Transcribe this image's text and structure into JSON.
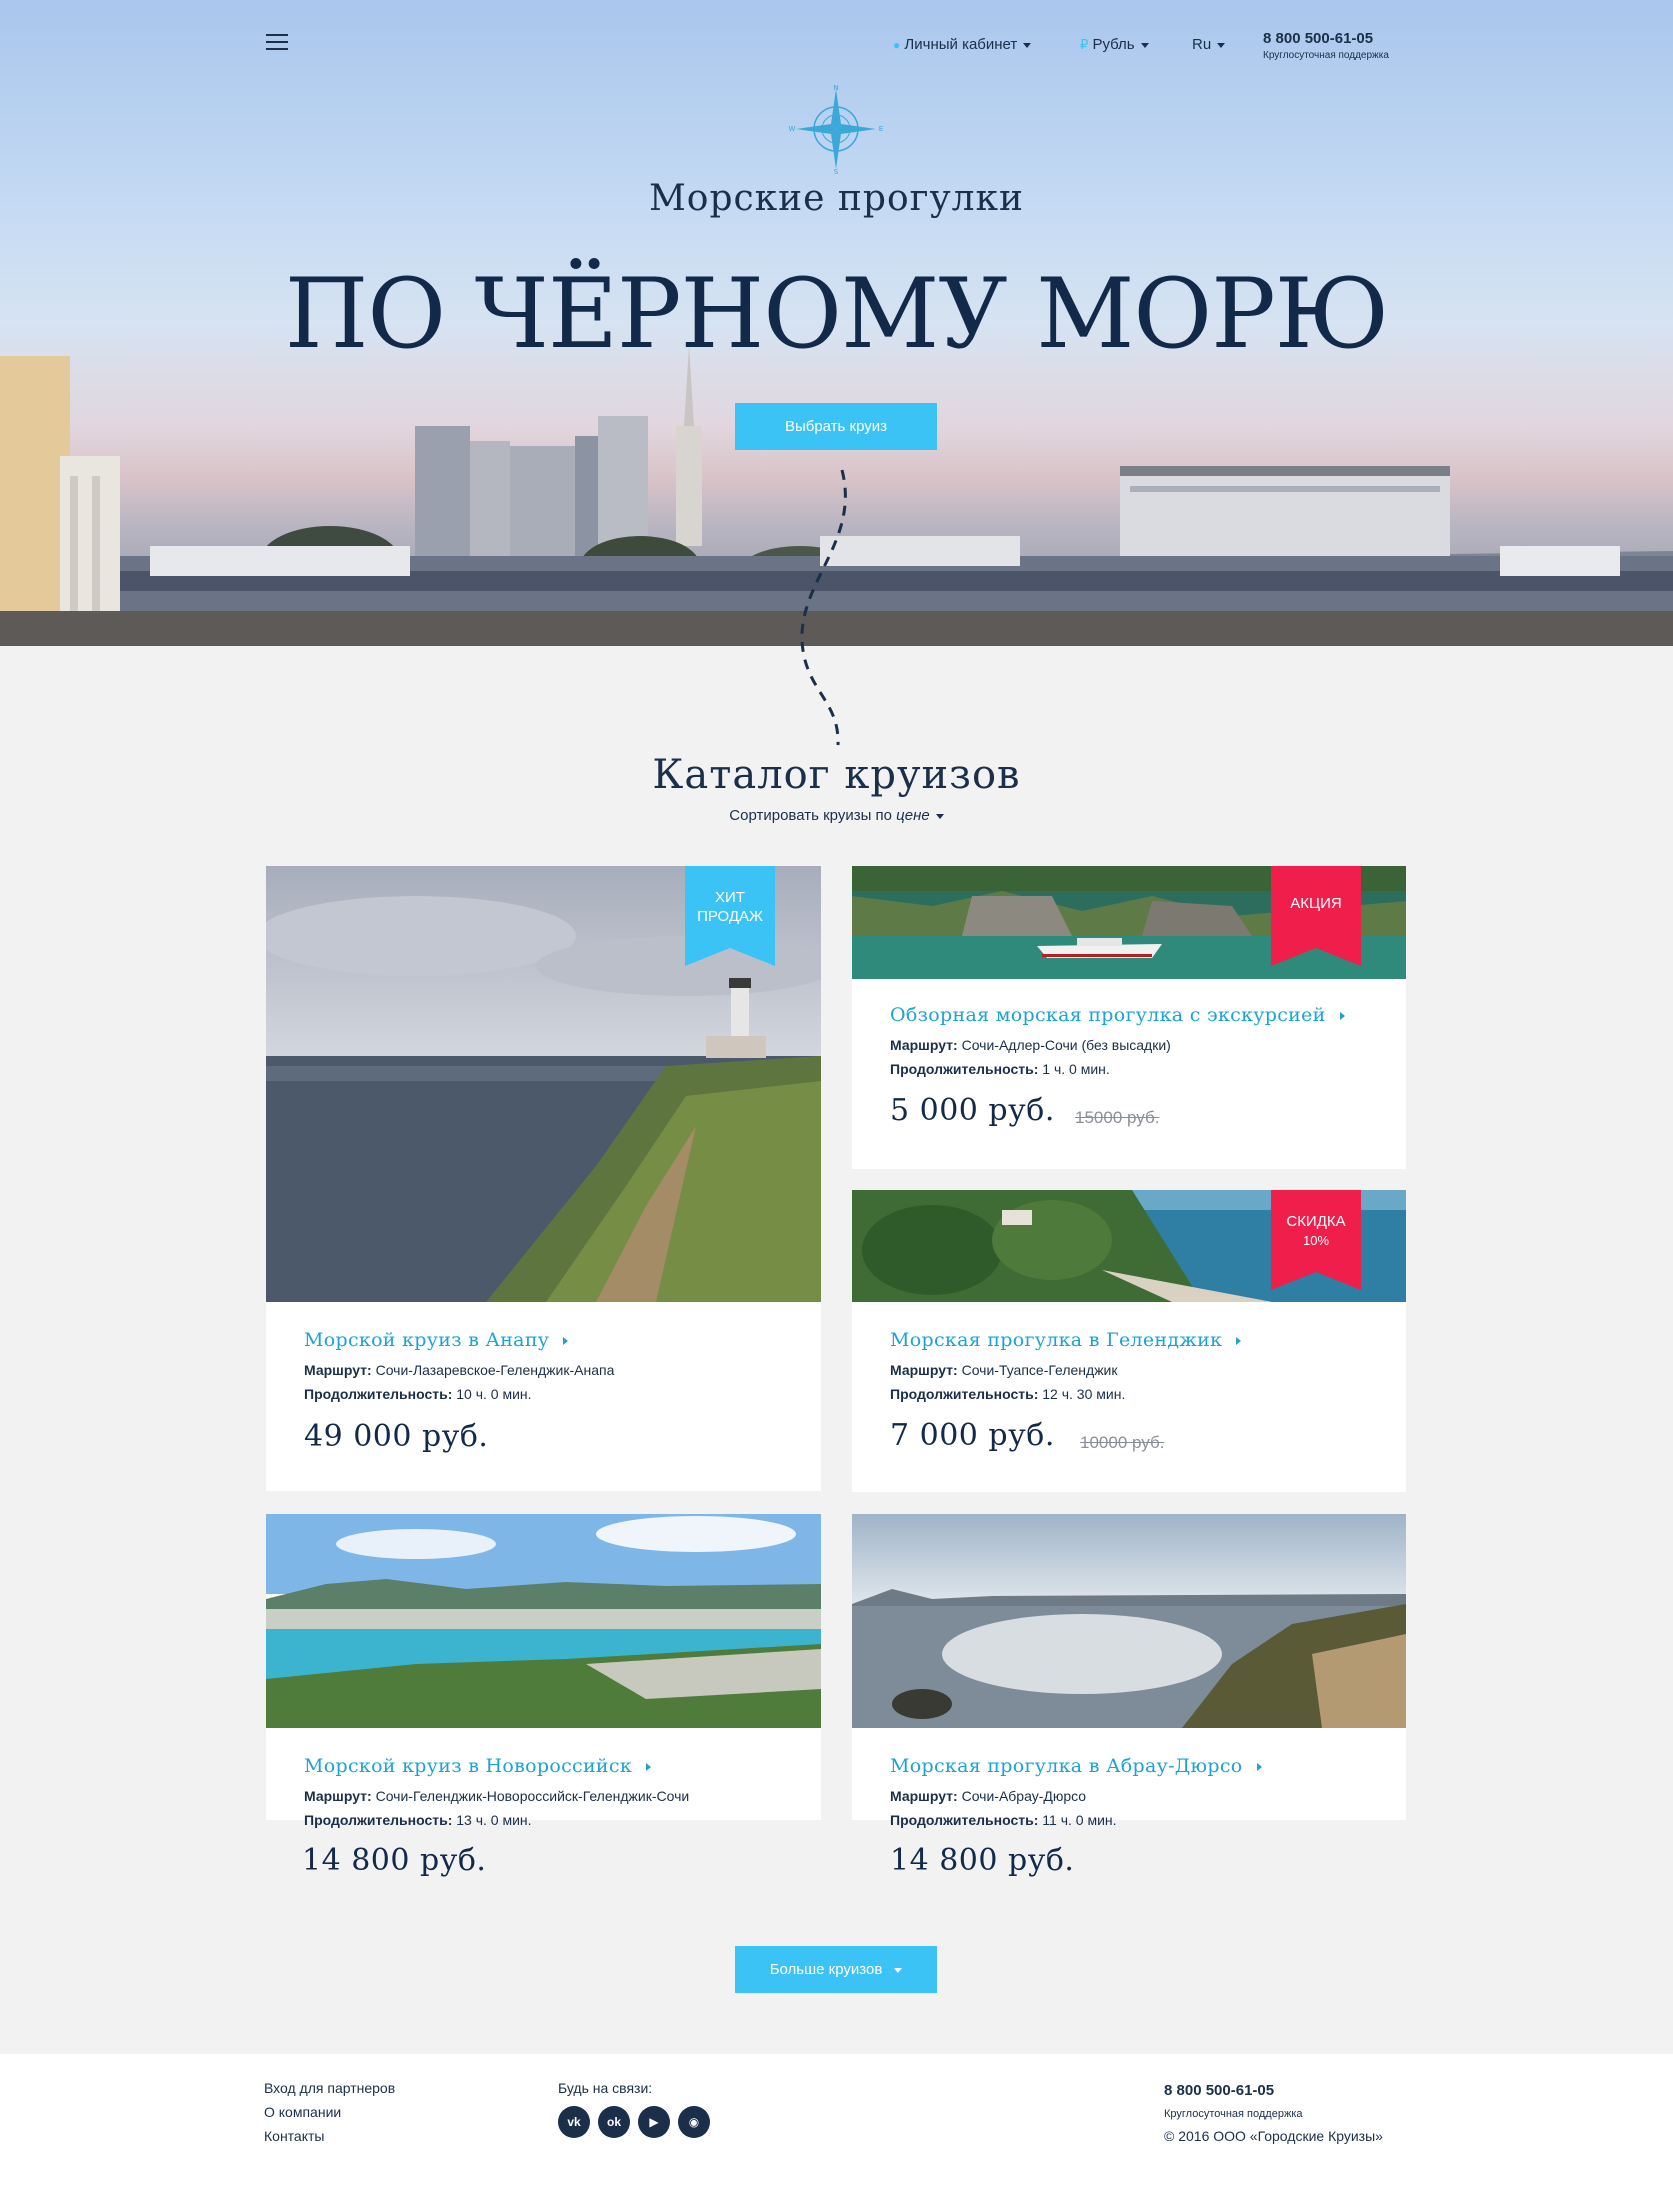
{
  "header": {
    "account_label": "Личный кабинет",
    "currency_label": "Рубль",
    "lang_label": "Ru",
    "phone": "8 800 500-61-05",
    "phone_note": "Круглосуточная поддержка"
  },
  "hero": {
    "subtitle": "Морские прогулки",
    "title": "ПО ЧЁРНОМУ МОРЮ",
    "cta_label": "Выбрать круиз"
  },
  "catalog": {
    "title": "Каталог круизов",
    "sort_prefix": "Сортировать круизы по",
    "sort_value": "цене",
    "route_label": "Маршрут:",
    "duration_label": "Продолжительность:",
    "more_label": "Больше круизов",
    "cards": [
      {
        "name": "Морской круиз в Анапу",
        "route": "Сочи-Лазаревское-Геленджик-Анапа",
        "duration": "10 ч. 0 мин.",
        "price": "49 000 руб.",
        "old_price": "",
        "badge": "ХИТ ПРОДАЖ",
        "badge_line1": "ХИТ",
        "badge_line2": "ПРОДАЖ",
        "badge_color": "#3cc3f5"
      },
      {
        "name": "Обзорная морская прогулка с экскурсией",
        "route": "Сочи-Адлер-Сочи (без высадки)",
        "duration": "1 ч. 0 мин.",
        "price": "5 000 руб.",
        "old_price": "15000 руб.",
        "badge": "АКЦИЯ",
        "badge_color": "#f01e4b"
      },
      {
        "name": "Морская прогулка в Геленджик",
        "route": "Сочи-Туапсе-Геленджик",
        "duration": "12 ч. 30 мин.",
        "price": "7 000 руб.",
        "old_price": "10000 руб.",
        "badge": "СКИДКА 10%",
        "badge_line1": "СКИДКА",
        "badge_line2": "10%",
        "badge_color": "#f01e4b"
      },
      {
        "name": "Морской круиз в Новороссийск",
        "route": "Сочи-Геленджик-Новороссийск-Геленджик-Сочи",
        "duration": "13 ч. 0 мин.",
        "price": "14 800 руб.",
        "old_price": ""
      },
      {
        "name": "Морская прогулка в Абрау-Дюрсо",
        "route": "Сочи-Абрау-Дюрсо",
        "duration": "11 ч. 0 мин.",
        "price": "14 800 руб.",
        "old_price": ""
      }
    ]
  },
  "footer": {
    "links": [
      "Вход для партнеров",
      "О компании",
      "Контакты"
    ],
    "social_label": "Будь на связи:",
    "social": [
      "vk-icon",
      "odnoklassniki-icon",
      "youtube-icon",
      "instagram-icon"
    ],
    "phone": "8 800 500-61-05",
    "phone_note": "Круглосуточная поддержка",
    "copyright": "© 2016 ООО «Городские Круизы»"
  }
}
